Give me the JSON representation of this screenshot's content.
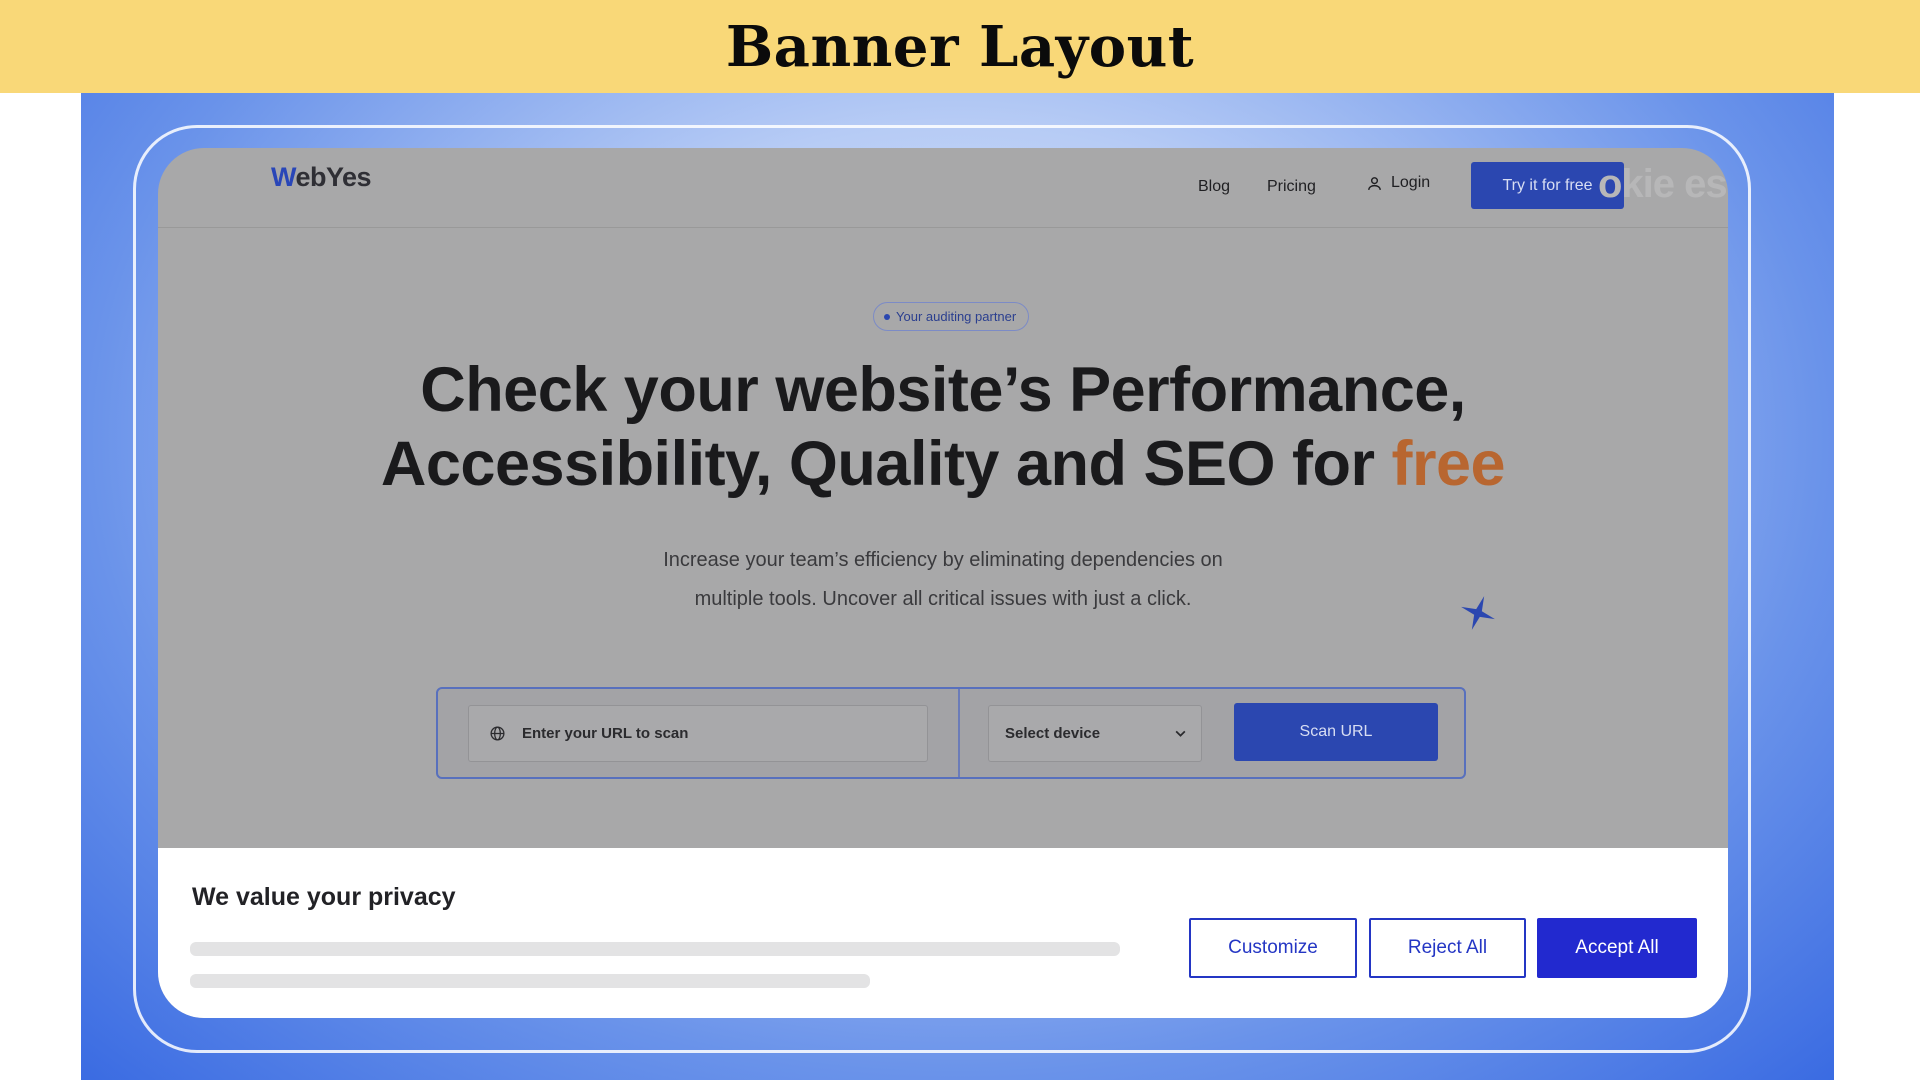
{
  "banner": {
    "title": "Banner Layout"
  },
  "site": {
    "logo_first": "W",
    "logo_rest": "ebYes",
    "nav": {
      "blog": "Blog",
      "pricing": "Pricing",
      "login": "Login",
      "cta": "Try it for free"
    },
    "ghost_brand": "okie es"
  },
  "hero": {
    "pill": "Your auditing partner",
    "headline_line1": "Check your website’s Performance,",
    "headline_line2_main": "Accessibility, Quality and SEO for ",
    "headline_line2_accent": "free",
    "sub_line1": "Increase your team’s efficiency by eliminating dependencies on",
    "sub_line2": "multiple tools. Uncover all critical issues with just a click."
  },
  "scan": {
    "url_placeholder": "Enter your URL to scan",
    "device_value": "Select device",
    "button": "Scan URL"
  },
  "cookie": {
    "title": "We value your privacy",
    "customize": "Customize",
    "reject": "Reject All",
    "accept": "Accept All"
  },
  "icons": [
    "user-icon",
    "globe-icon",
    "chevron-down-icon",
    "sparkle-icon"
  ],
  "colors": {
    "banner": "#f9d878",
    "brand_blue": "#2b47b0",
    "accent_free": "#b86630",
    "accept": "#2229cf"
  }
}
